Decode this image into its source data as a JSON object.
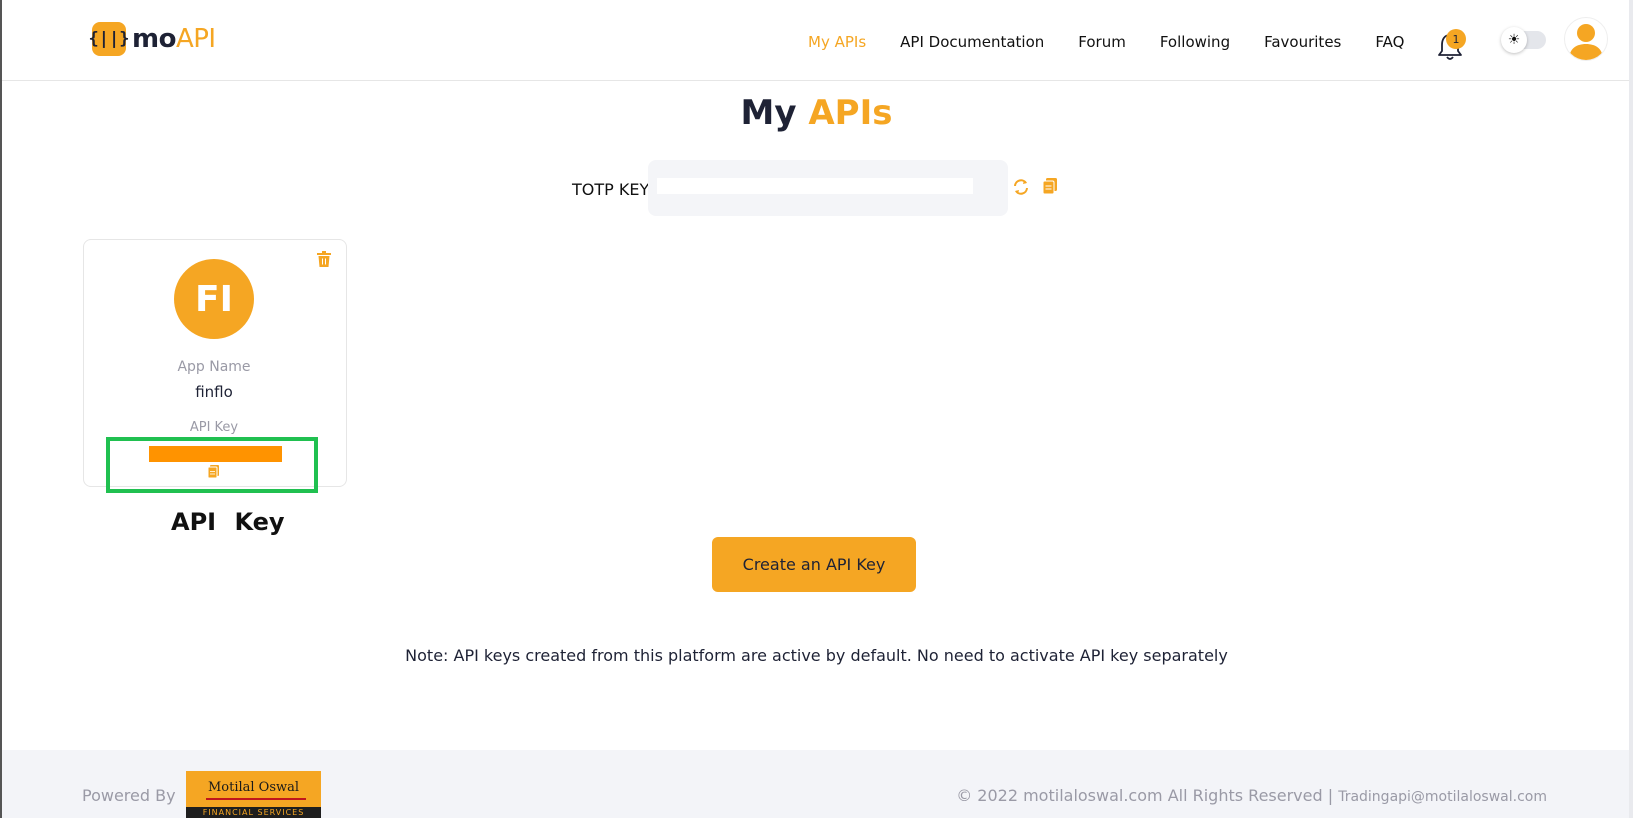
{
  "header": {
    "logo": {
      "prefix": "mo",
      "suffix": "API",
      "mark": "{||}"
    },
    "nav": [
      {
        "label": "My APIs",
        "active": true
      },
      {
        "label": "API Documentation"
      },
      {
        "label": "Forum"
      },
      {
        "label": "Following"
      },
      {
        "label": "Favourites"
      },
      {
        "label": "FAQ"
      }
    ],
    "notification_count": "1",
    "theme_toggle_icon": "☀",
    "icons": {
      "bell": "bell-icon",
      "avatar": "user-avatar-icon",
      "theme": "sun-icon"
    }
  },
  "page": {
    "title_part1": "My",
    "title_part2": "APIs"
  },
  "totp": {
    "label": "TOTP KEY:",
    "icons": {
      "refresh": "refresh-icon",
      "copy": "copy-icon"
    }
  },
  "app_card": {
    "initials": "FI",
    "app_name_label": "App Name",
    "app_name": "finflo",
    "api_key_label": "API Key",
    "icons": {
      "delete": "trash-icon",
      "copy": "copy-icon"
    }
  },
  "annotation": {
    "text": "API Key"
  },
  "actions": {
    "create_label": "Create an API Key"
  },
  "note": "Note: API keys created from this platform are active by default. No need to activate API key separately",
  "footer": {
    "powered_by": "Powered By",
    "partner_logo": {
      "name": "Motilal Oswal",
      "sub": "FINANCIAL SERVICES"
    },
    "copyright": "© 2022 motilaloswal.com All Rights Reserved | ",
    "email": "Tradingapi@motilaloswal.com"
  },
  "colors": {
    "accent": "#f5a623",
    "dark": "#1e2235",
    "highlight": "#20c050",
    "key_redaction": "#ff9300"
  }
}
